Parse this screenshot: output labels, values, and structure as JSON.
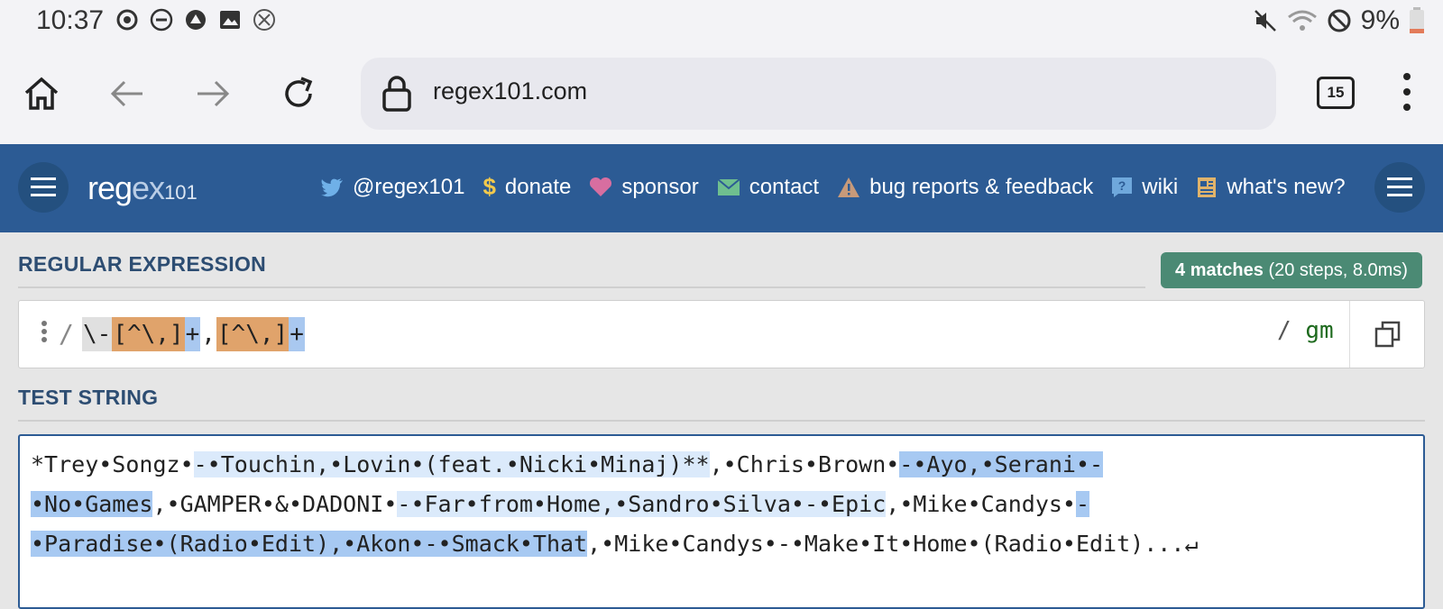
{
  "status_bar": {
    "time": "10:37",
    "battery": "9%",
    "icons": [
      "sync-icon",
      "dnd-icon",
      "app-icon",
      "image-icon",
      "x-circle-icon"
    ],
    "right_icons": [
      "mute-icon",
      "wifi-icon",
      "blocked-icon",
      "battery-icon"
    ]
  },
  "browser": {
    "url": "regex101.com",
    "tab_count": "15"
  },
  "header": {
    "logo_reg": "reg",
    "logo_ex": "ex",
    "logo_num": "101",
    "nav": [
      {
        "label": "@regex101",
        "icon": "twitter-icon",
        "color": "#6fb0e8"
      },
      {
        "label": "donate",
        "icon": "dollar-icon",
        "color": "#f2c94c"
      },
      {
        "label": "sponsor",
        "icon": "heart-icon",
        "color": "#d76ea0"
      },
      {
        "label": "contact",
        "icon": "mail-icon",
        "color": "#6fbf8f"
      },
      {
        "label": "bug reports & feedback",
        "icon": "warning-icon",
        "color": "#c79a7a"
      },
      {
        "label": "wiki",
        "icon": "help-icon",
        "color": "#6fa8dc"
      },
      {
        "label": "what's new?",
        "icon": "news-icon",
        "color": "#e0b36b"
      }
    ]
  },
  "regex_section": {
    "title": "REGULAR EXPRESSION",
    "matches_bold": "4 matches",
    "matches_detail": "(20 steps, 8.0ms)",
    "delimiter": "/",
    "tokens": [
      "\\-",
      "[^\\,]",
      "+",
      ",",
      "[^\\,]",
      "+"
    ],
    "flags": "gm"
  },
  "test_section": {
    "title": "TEST STRING",
    "segments": [
      {
        "text": "*Trey•Songz•",
        "match": 0
      },
      {
        "text": "-•Touchin,•Lovin•(feat.•Nicki•Minaj)**",
        "match": 1
      },
      {
        "text": ",•Chris•Brown•",
        "match": 0
      },
      {
        "text": "-•Ayo,•Serani•-•No•Games",
        "match": 2
      },
      {
        "text": ",•GAMPER•&•DADONI•",
        "match": 0
      },
      {
        "text": "-•Far•from•Home,•Sandro•Silva•-•Epic",
        "match": 1
      },
      {
        "text": ",•Mike•Candys•",
        "match": 0
      },
      {
        "text": "-•Paradise•(Radio•Edit),•Akon•-•Smack•That",
        "match": 2
      },
      {
        "text": ",•Mike•Candys•-•Make•It•Home•(Radio•Edit)...↵",
        "match": 0
      }
    ]
  }
}
